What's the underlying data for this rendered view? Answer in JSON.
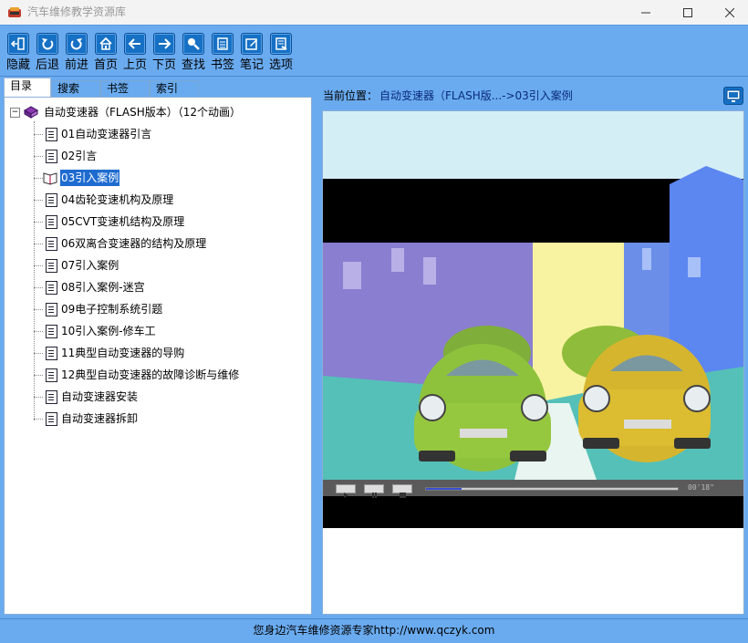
{
  "window": {
    "title": "汽车维修教学资源库",
    "icon": "app-logo-icon",
    "controls": [
      "minimize-icon",
      "maximize-icon",
      "close-icon"
    ]
  },
  "toolbar": {
    "buttons": [
      {
        "label": "隐藏",
        "icon": "hide-panel-icon"
      },
      {
        "label": "后退",
        "icon": "back-icon"
      },
      {
        "label": "前进",
        "icon": "forward-icon"
      },
      {
        "label": "首页",
        "icon": "home-icon"
      },
      {
        "label": "上页",
        "icon": "prev-page-icon"
      },
      {
        "label": "下页",
        "icon": "next-page-icon"
      },
      {
        "label": "查找",
        "icon": "search-icon"
      },
      {
        "label": "书签",
        "icon": "bookmark-icon"
      },
      {
        "label": "笔记",
        "icon": "notes-icon"
      },
      {
        "label": "选项",
        "icon": "options-icon"
      }
    ]
  },
  "tabs": [
    {
      "label": "目录",
      "active": true
    },
    {
      "label": "搜索",
      "active": false
    },
    {
      "label": "书签",
      "active": false
    },
    {
      "label": "索引",
      "active": false
    }
  ],
  "tree": {
    "root": {
      "label": "自动变速器（FLASH版本）（12个动画）",
      "icon": "book-icon",
      "expander": "⊟"
    },
    "items": [
      {
        "label": "01自动变速器引言",
        "selected": false
      },
      {
        "label": "02引言",
        "selected": false
      },
      {
        "label": "03引入案例",
        "selected": true
      },
      {
        "label": "04齿轮变速机构及原理",
        "selected": false
      },
      {
        "label": "05CVT变速机结构及原理",
        "selected": false
      },
      {
        "label": "06双离合变速器的结构及原理",
        "selected": false
      },
      {
        "label": "07引入案例",
        "selected": false
      },
      {
        "label": "08引入案例-迷宫",
        "selected": false
      },
      {
        "label": "09电子控制系统引题",
        "selected": false
      },
      {
        "label": "10引入案例-修车工",
        "selected": false
      },
      {
        "label": "11典型自动变速器的导购",
        "selected": false
      },
      {
        "label": "12典型自动变速器的故障诊断与维修",
        "selected": false
      },
      {
        "label": "自动变速器安装",
        "selected": false
      },
      {
        "label": "自动变速器拆卸",
        "selected": false
      }
    ]
  },
  "breadcrumb": {
    "label": "当前位置：",
    "value": "自动变速器（FLASH版...->03引入案例"
  },
  "player": {
    "time": "00'18\"",
    "progress": 0.14,
    "controls": [
      "play-icon",
      "pause-icon",
      "stop-icon"
    ]
  },
  "status": {
    "text": "您身边汽车维修资源专家http://www.qczyk.com"
  },
  "colors": {
    "chrome": "#6aabf0",
    "selection": "#1e6bd0",
    "button": "#1670c4"
  }
}
